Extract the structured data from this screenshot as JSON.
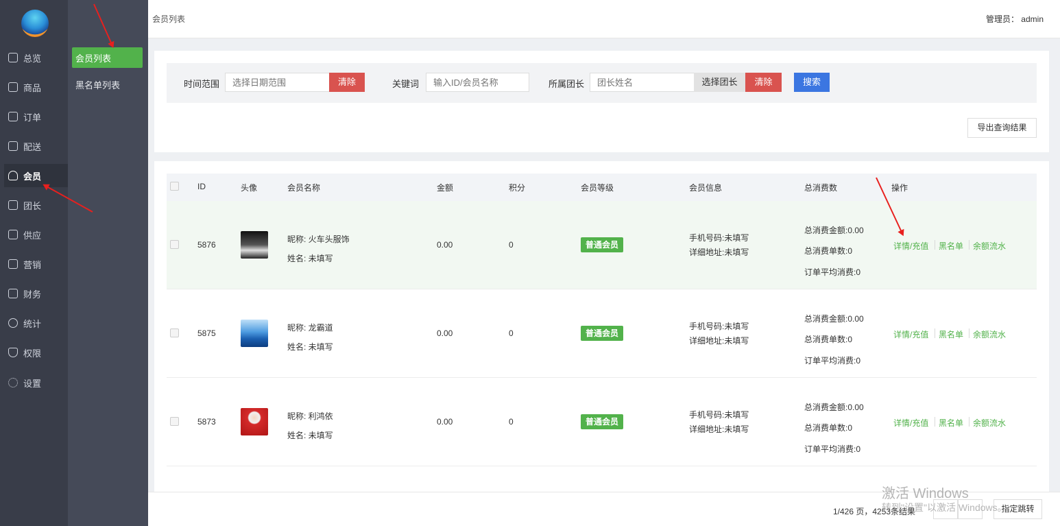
{
  "header": {
    "breadcrumb": "会员列表",
    "admin": "管理员： admin"
  },
  "rail": {
    "items": [
      {
        "label": "总览",
        "icon": "home-icon"
      },
      {
        "label": "商品",
        "icon": "goods-icon"
      },
      {
        "label": "订单",
        "icon": "order-icon"
      },
      {
        "label": "配送",
        "icon": "delivery-icon"
      },
      {
        "label": "会员",
        "icon": "user-icon",
        "active": true
      },
      {
        "label": "团长",
        "icon": "leader-icon"
      },
      {
        "label": "供应",
        "icon": "supply-icon"
      },
      {
        "label": "营销",
        "icon": "gift-icon"
      },
      {
        "label": "财务",
        "icon": "finance-icon"
      },
      {
        "label": "统计",
        "icon": "chart-icon"
      },
      {
        "label": "权限",
        "icon": "shield-icon"
      },
      {
        "label": "设置",
        "icon": "gear-icon"
      }
    ]
  },
  "submenu": {
    "items": [
      {
        "label": "会员列表",
        "active": true
      },
      {
        "label": "黑名单列表"
      }
    ]
  },
  "filter": {
    "time_label": "时间范围",
    "time_placeholder": "选择日期范围",
    "clear1": "清除",
    "keyword_label": "关键词",
    "keyword_placeholder": "输入ID/会员名称",
    "leader_label": "所属团长",
    "leader_placeholder": "团长姓名",
    "choose_leader": "选择团长",
    "clear2": "清除",
    "search": "搜索",
    "export": "导出查询结果"
  },
  "table": {
    "headers": {
      "id": "ID",
      "avatar": "头像",
      "name": "会员名称",
      "amount": "金额",
      "points": "积分",
      "level": "会员等级",
      "info": "会员信息",
      "total": "总消费数",
      "ops": "操作"
    },
    "rows": [
      {
        "id": "5876",
        "nickname": "昵称: 火车头服饰",
        "realname": "姓名: 未填写",
        "amount": "0.00",
        "points": "0",
        "level": "普通会员",
        "phone": "手机号码:未填写",
        "address": "详细地址:未填写",
        "sum_amount": "总消费金额:0.00",
        "sum_orders": "总消费单数:0",
        "avg": "订单平均消费:0",
        "op1": "详情/充值",
        "op2": "黑名单",
        "op3": "余额流水"
      },
      {
        "id": "5875",
        "nickname": "昵称: 龙霸道",
        "realname": "姓名: 未填写",
        "amount": "0.00",
        "points": "0",
        "level": "普通会员",
        "phone": "手机号码:未填写",
        "address": "详细地址:未填写",
        "sum_amount": "总消费金额:0.00",
        "sum_orders": "总消费单数:0",
        "avg": "订单平均消费:0",
        "op1": "详情/充值",
        "op2": "黑名单",
        "op3": "余额流水"
      },
      {
        "id": "5873",
        "nickname": "昵称: 利鸿依",
        "realname": "姓名: 未填写",
        "amount": "0.00",
        "points": "0",
        "level": "普通会员",
        "phone": "手机号码:未填写",
        "address": "详细地址:未填写",
        "sum_amount": "总消费金额:0.00",
        "sum_orders": "总消费单数:0",
        "avg": "订单平均消费:0",
        "op1": "详情/充值",
        "op2": "黑名单",
        "op3": "余额流水"
      }
    ]
  },
  "pager": {
    "text": "1/426 页，4253条结果",
    "jump": "指定跳转"
  },
  "watermark": {
    "line1": "激活 Windows",
    "line2": "转到\"设置\"以激活 Windows。"
  },
  "colors": {
    "accent": "#52b24b",
    "danger": "#d9534f",
    "primary": "#3b76e1",
    "sidebar": "#393d49"
  }
}
